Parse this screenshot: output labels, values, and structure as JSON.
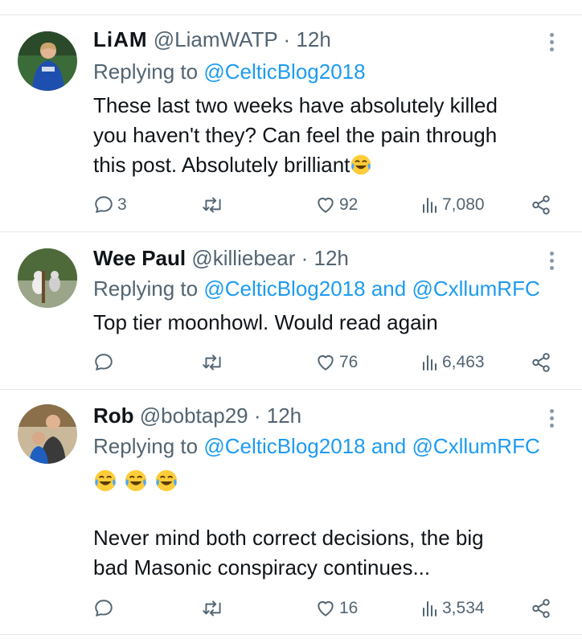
{
  "colors": {
    "link": "#1d9bf0",
    "secondary": "#536471",
    "divider": "#e7e9ea",
    "text": "#0f1419"
  },
  "icons": {
    "reply": "speech-bubble-icon",
    "retweet": "retweet-arrows-icon",
    "like": "heart-icon",
    "views": "bar-chart-icon",
    "share": "share-nodes-icon",
    "more": "vertical-dots-icon",
    "emoji": "face-with-tears-of-joy-emoji"
  },
  "tweets": [
    {
      "name": "LiAM",
      "handle": "@LiamWATP",
      "separator": "·",
      "time": "12h",
      "replying_prefix": "Replying to",
      "replying_to": "@CelticBlog2018",
      "replying_and": "",
      "replying_to_2": "",
      "text_lines": [
        "These last two weeks have absolutely killed",
        "you haven't they? Can feel the pain through",
        "this post. Absolutely brilliant"
      ],
      "replies": "3",
      "retweets": "",
      "likes": "92",
      "views": "7,080"
    },
    {
      "name": "Wee Paul",
      "handle": "@killiebear",
      "separator": "·",
      "time": "12h",
      "replying_prefix": "Replying to",
      "replying_to": "@CelticBlog2018",
      "replying_and": "and",
      "replying_to_2": "@CxllumRFC",
      "text_lines": [
        "Top tier moonhowl. Would read again"
      ],
      "replies": "",
      "retweets": "",
      "likes": "76",
      "views": "6,463"
    },
    {
      "name": "Rob",
      "handle": "@bobtap29",
      "separator": "·",
      "time": "12h",
      "replying_prefix": "Replying to",
      "replying_to": "@CelticBlog2018",
      "replying_and": "and",
      "replying_to_2": "@CxllumRFC",
      "text_lines": [
        "Never mind both correct decisions, the big",
        "bad Masonic conspiracy continues..."
      ],
      "replies": "",
      "retweets": "",
      "likes": "16",
      "views": "3,534"
    }
  ]
}
